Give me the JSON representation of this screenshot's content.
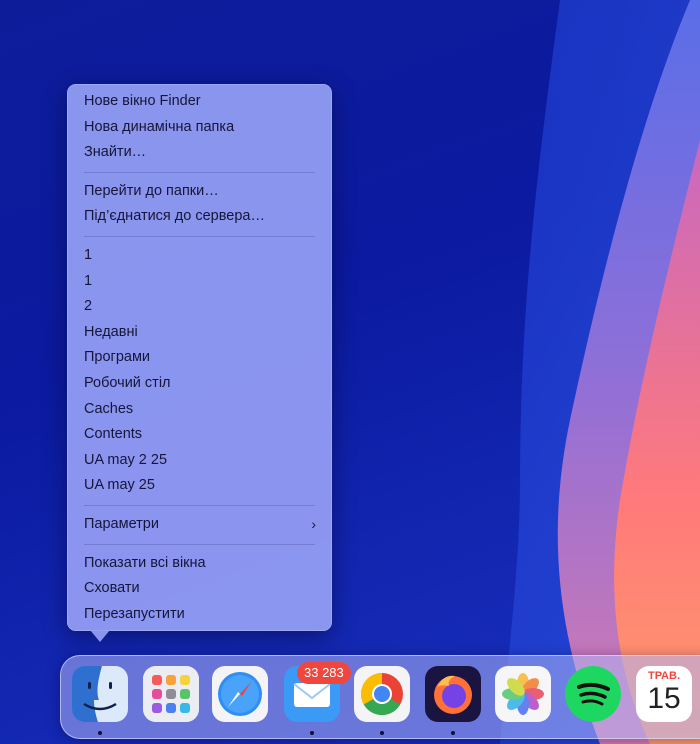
{
  "context_menu": {
    "group1": [
      "Нове вікно Finder",
      "Нова динамічна папка",
      "Знайти…"
    ],
    "group2": [
      "Перейти до папки…",
      "Під’єднатися до сервера…"
    ],
    "group3": [
      "1",
      "1",
      "2",
      "Недавні",
      "Програми",
      "Робочий стіл",
      "Caches",
      "Contents",
      "UA may 2 25",
      "UA may 25"
    ],
    "options_label": "Параметри",
    "group5": [
      "Показати всі вікна",
      "Сховати",
      "Перезапустити"
    ]
  },
  "dock": {
    "apps": [
      "finder-icon",
      "launchpad-icon",
      "safari-icon",
      "mail-icon",
      "chrome-icon",
      "firefox-icon",
      "photos-icon",
      "spotify-icon",
      "calendar-icon"
    ],
    "mail_badge": "33 283",
    "calendar_month": "ТРАВ.",
    "calendar_day": "15"
  },
  "colors": {
    "menu_bg": "#96a0f5",
    "wallpaper_blue": "#0d1d9a",
    "badge_red": "#f0463d"
  }
}
